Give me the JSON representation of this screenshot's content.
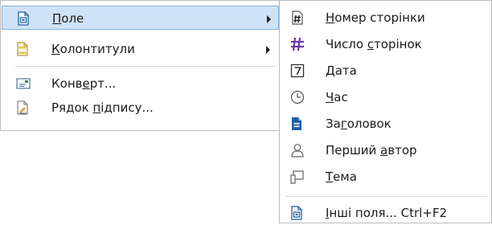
{
  "main_menu": {
    "items": [
      {
        "label_pre": "",
        "label_u": "П",
        "label_post": "оле",
        "icon": "field-doc-icon",
        "submenu": true
      },
      {
        "label_pre": "",
        "label_u": "К",
        "label_post": "олонтитули",
        "icon": "header-footer-icon",
        "submenu": true
      },
      {
        "label_pre": "Конв",
        "label_u": "е",
        "label_post": "рт...",
        "icon": "envelope-icon",
        "submenu": false
      },
      {
        "label_pre": "Рядок ",
        "label_u": "п",
        "label_post": "ідпису...",
        "icon": "signature-line-icon",
        "submenu": false
      }
    ]
  },
  "sub_menu": {
    "items": [
      {
        "label_pre": "",
        "label_u": "Н",
        "label_post": "омер сторінки",
        "icon": "page-number-icon"
      },
      {
        "label_pre": "Число ",
        "label_u": "с",
        "label_post": "торінок",
        "icon": "page-count-icon"
      },
      {
        "label_pre": "",
        "label_u": "Д",
        "label_post": "ата",
        "icon": "date-icon"
      },
      {
        "label_pre": "",
        "label_u": "Ч",
        "label_post": "ас",
        "icon": "clock-icon"
      },
      {
        "label_pre": "За",
        "label_u": "г",
        "label_post": "оловок",
        "icon": "title-doc-icon"
      },
      {
        "label_pre": "Перший ",
        "label_u": "а",
        "label_post": "втор",
        "icon": "author-icon"
      },
      {
        "label_pre": "",
        "label_u": "Т",
        "label_post": "ема",
        "icon": "subject-icon"
      },
      {
        "label_pre": "",
        "label_u": "І",
        "label_post": "нші поля...",
        "shortcut": "Ctrl+F2",
        "icon": "more-fields-icon"
      }
    ]
  },
  "colors": {
    "highlight_bg": "#cfe3f7",
    "highlight_border": "#84b2e0",
    "icon_blue": "#1f5fa8"
  }
}
